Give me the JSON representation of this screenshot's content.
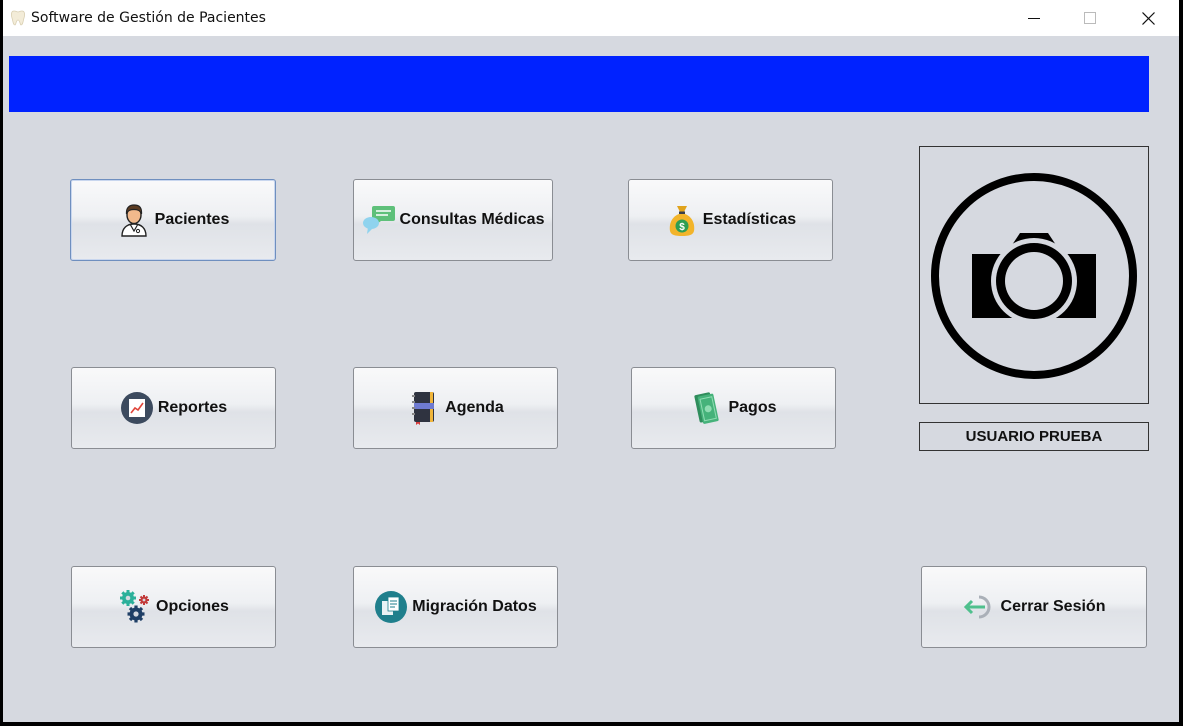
{
  "window": {
    "title": "Software de Gestión de Pacientes"
  },
  "colors": {
    "banner": "#0022ff",
    "background": "#d6d9e0"
  },
  "buttons": {
    "pacientes": {
      "label": "Pacientes",
      "icon": "doctor-icon"
    },
    "consultas": {
      "label": "Consultas Médicas",
      "icon": "chat-bubbles-icon"
    },
    "estadisticas": {
      "label": "Estadísticas",
      "icon": "money-bag-icon"
    },
    "reportes": {
      "label": "Reportes",
      "icon": "report-chart-icon"
    },
    "agenda": {
      "label": "Agenda",
      "icon": "notebook-icon"
    },
    "pagos": {
      "label": "Pagos",
      "icon": "banknotes-icon"
    },
    "opciones": {
      "label": "Opciones",
      "icon": "gears-icon"
    },
    "migracion": {
      "label": "Migración Datos",
      "icon": "documents-icon"
    },
    "cerrar_sesion": {
      "label": "Cerrar Sesión",
      "icon": "logout-icon"
    }
  },
  "user": {
    "name": "USUARIO PRUEBA",
    "photo_icon": "camera-icon"
  }
}
